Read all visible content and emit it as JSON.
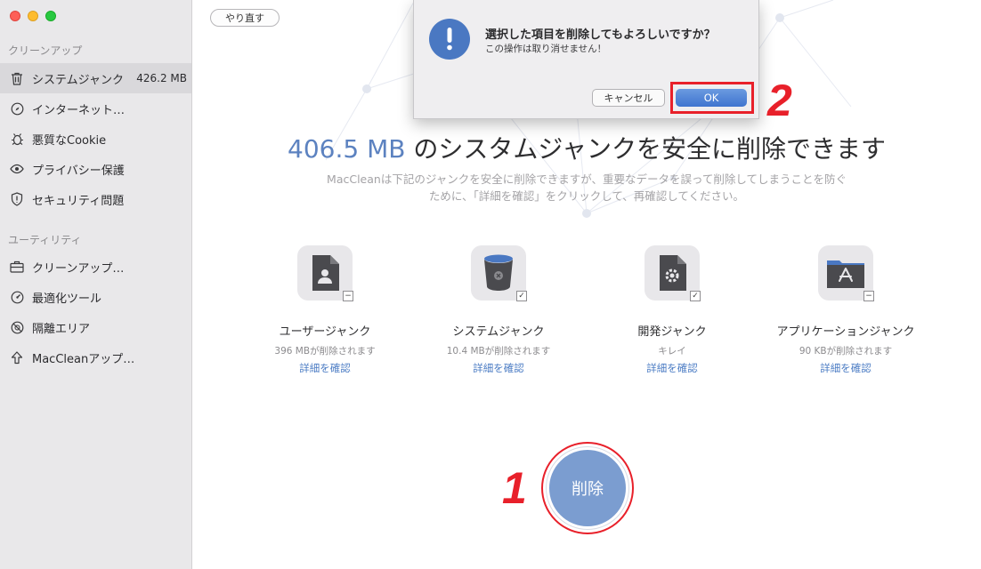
{
  "sidebar": {
    "section_cleanup": "クリーンアップ",
    "section_utility": "ユーティリティ",
    "items": [
      {
        "label": "システムジャンク",
        "size": "426.2 MB",
        "icon": "trash-icon"
      },
      {
        "label": "インターネット…",
        "icon": "compass-icon"
      },
      {
        "label": "悪質なCookie",
        "icon": "bug-icon"
      },
      {
        "label": "プライバシー保護",
        "icon": "eye-icon"
      },
      {
        "label": "セキュリティ問題",
        "icon": "shield-icon"
      }
    ],
    "utility_items": [
      {
        "label": "クリーンアップ…",
        "icon": "briefcase-icon"
      },
      {
        "label": "最適化ツール",
        "icon": "gauge-icon"
      },
      {
        "label": "隔離エリア",
        "icon": "quarantine-icon"
      },
      {
        "label": "MacCleanアップ…",
        "icon": "upload-icon"
      }
    ]
  },
  "toolbar": {
    "redo_label": "やり直す"
  },
  "main": {
    "headline_amount": "406.5 MB",
    "headline_text": " のシスタムジャンクを安全に削除できます",
    "description": "MacCleanは下記のジャンクを安全に削除できますが、重要なデータを誤って削除してしまうことを防ぐために、「詳細を確認」をクリックして、再確認してください。",
    "categories": [
      {
        "name": "ユーザージャンク",
        "status": "396 MBが削除されます",
        "link": "詳細を確認",
        "check": "−"
      },
      {
        "name": "システムジャンク",
        "status": "10.4 MBが削除されます",
        "link": "詳細を確認",
        "check": "✓"
      },
      {
        "name": "開発ジャンク",
        "status": "キレイ",
        "link": "詳細を確認",
        "check": "✓"
      },
      {
        "name": "アプリケーションジャンク",
        "status": "90 KBが削除されます",
        "link": "詳細を確認",
        "check": "−"
      }
    ],
    "delete_label": "削除"
  },
  "dialog": {
    "title": "選択した項目を削除してもよろしいですか？",
    "message": "この操作は取り消せません！",
    "cancel_label": "キャンセル",
    "ok_label": "OK"
  },
  "annotations": {
    "step1": "1",
    "step2": "2"
  },
  "colors": {
    "accent": "#5c82c0",
    "annotation": "#e8202a",
    "link": "#4b7cc4"
  }
}
